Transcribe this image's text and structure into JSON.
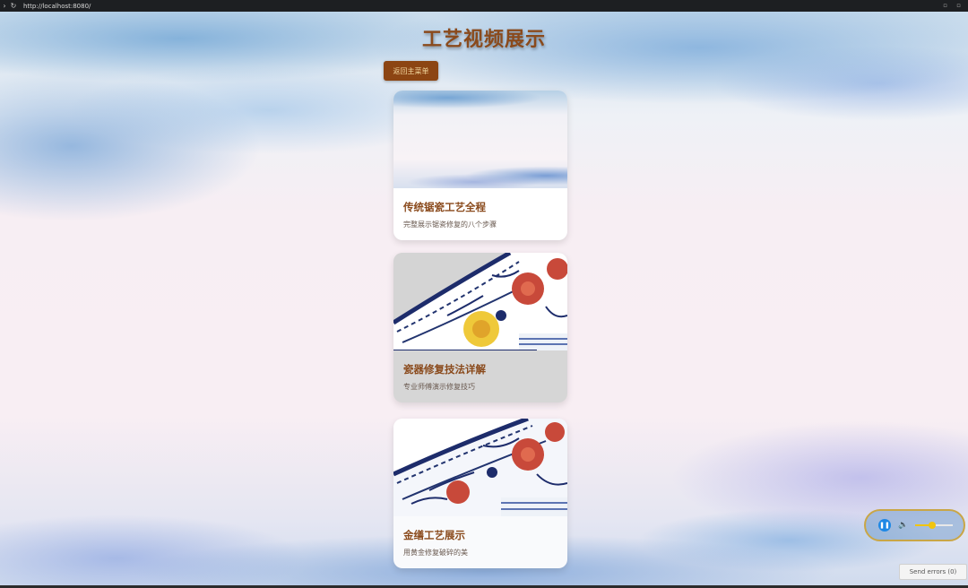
{
  "browser": {
    "url": "http://localhost:8080/"
  },
  "page": {
    "title": "工艺视频展示",
    "back_button": "返回主菜单"
  },
  "videos": [
    {
      "title": "传统锯瓷工艺全程",
      "description": "完整展示锯瓷修复的八个步骤"
    },
    {
      "title": "瓷器修复技法详解",
      "description": "专业师傅演示修复技巧"
    },
    {
      "title": "金缮工艺展示",
      "description": "用黄金修复破碎的美"
    }
  ],
  "audio_player": {
    "state": "playing",
    "volume": 0.45,
    "accent_color": "#f1c40f"
  },
  "send_errors": "Send errors (0)",
  "colors": {
    "title": "#8a4a1c",
    "button_bg": "#8c4513",
    "button_text": "#f4d9a0"
  }
}
